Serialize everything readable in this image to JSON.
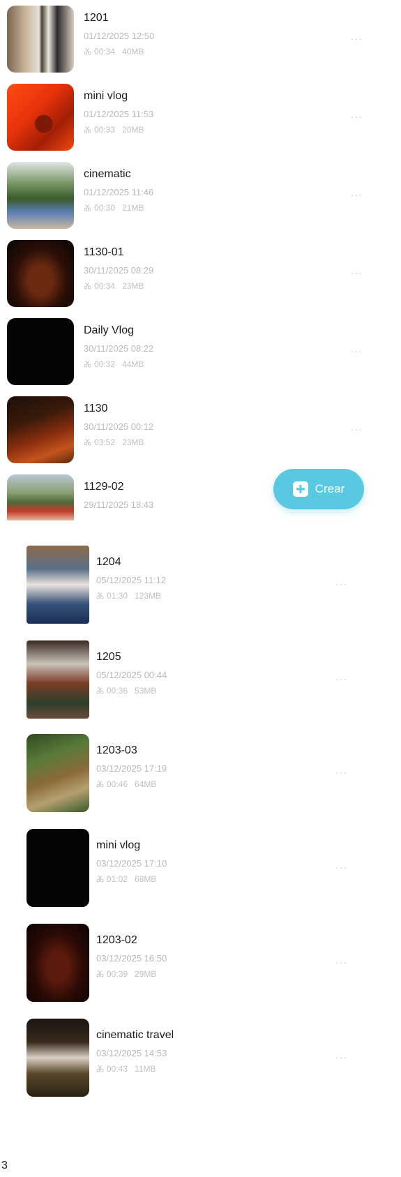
{
  "videos_top": [
    {
      "title": "1201",
      "date": "01/12/2025 12:50",
      "duration": "00:34",
      "size": "40MB",
      "thumb": "people-outdoor"
    },
    {
      "title": "mini vlog",
      "date": "01/12/2025 11:53",
      "duration": "00:33",
      "size": "20MB",
      "thumb": "red-wall"
    },
    {
      "title": "cinematic",
      "date": "01/12/2025 11:46",
      "duration": "00:30",
      "size": "21MB",
      "thumb": "garden-balcony"
    },
    {
      "title": "1130-01",
      "date": "30/11/2025 08:29",
      "duration": "00:34",
      "size": "23MB",
      "thumb": "dark-tunnel"
    },
    {
      "title": "Daily Vlog",
      "date": "30/11/2025 08:22",
      "duration": "00:32",
      "size": "44MB",
      "thumb": "black"
    },
    {
      "title": "1130",
      "date": "30/11/2025 00:12",
      "duration": "03:52",
      "size": "23MB",
      "thumb": "red-path"
    },
    {
      "title": "1129-02",
      "date": "29/11/2025 18:43",
      "duration": "",
      "size": "",
      "thumb": "mountain-group"
    }
  ],
  "videos_bottom": [
    {
      "title": "1204",
      "date": "05/12/2025 11:12",
      "duration": "01:30",
      "size": "123MB",
      "thumb": "group-photo"
    },
    {
      "title": "1205",
      "date": "05/12/2025 00:44",
      "duration": "00:36",
      "size": "53MB",
      "thumb": "building-group"
    },
    {
      "title": "1203-03",
      "date": "03/12/2025 17:19",
      "duration": "00:46",
      "size": "64MB",
      "thumb": "forest-path"
    },
    {
      "title": "mini vlog",
      "date": "03/12/2025 17:10",
      "duration": "01:02",
      "size": "68MB",
      "thumb": "black"
    },
    {
      "title": "1203-02",
      "date": "03/12/2025 16:50",
      "duration": "00:39",
      "size": "29MB",
      "thumb": "dark-red"
    },
    {
      "title": "cinematic travel",
      "date": "03/12/2025 14:53",
      "duration": "00:43",
      "size": "11MB",
      "thumb": "crowd"
    }
  ],
  "more_label": "···",
  "fab": {
    "label": "Crear"
  },
  "page_number": "3",
  "colors": {
    "accent": "#59c9e2",
    "meta": "#b9b9b9"
  }
}
